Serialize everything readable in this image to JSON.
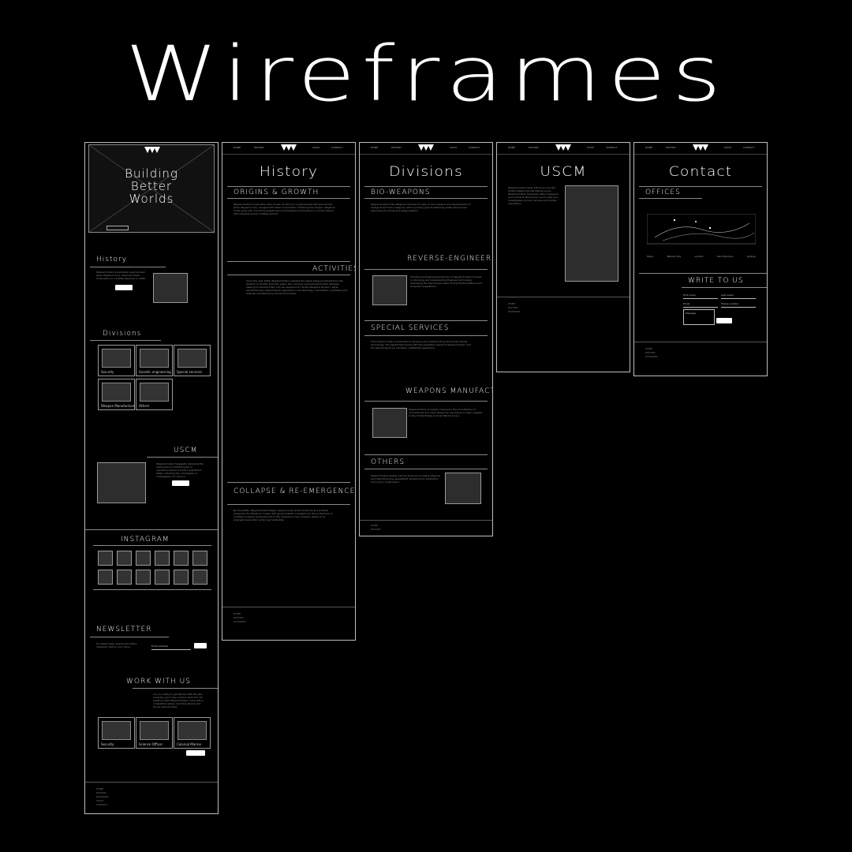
{
  "title": "Wireframes",
  "nav": [
    "HOME",
    "HISTORY",
    "DIVISIONS",
    "USCM",
    "CONTACT"
  ],
  "home": {
    "hero": [
      "Building",
      "Better",
      "Worlds"
    ],
    "history_title": "History",
    "history_text": "Weyland-Yutani Corporation was founded when Weyland Corp. Acquired Yutani Corporation in a hostile takeover in 2099.",
    "divisions_title": "Divisions",
    "divisions": [
      "Security",
      "Genetic engineering",
      "Special services",
      "Weapon Manufacture",
      "Others"
    ],
    "uscm_title": "USCM",
    "uscm_text": "Weyland-Yutani frequently demands the deployment of USCM troops in operations where it holds a significant stake, including the colonization or investigation of colony's.",
    "instagram_title": "Instagram",
    "newsletter_title": "Newsletter",
    "newsletter_text": "For latest news, events and offers, delivered right to your inbox.",
    "email_placeholder": "Email address",
    "work_title": "Work with us",
    "work_text": "Are you ready to get started with the last company you'll ever need to work for? All positions with Weyland-Yutani come with a competitive salary including shares and bonus opportunities.",
    "work_cards": [
      "Security",
      "Science Officer",
      "Colonial Marine"
    ]
  },
  "history": {
    "title": "History",
    "s1": "Origins & Growth",
    "s1_text": "Weyland-Yutani Corporation (also known as WY) is a conglomerate that was formed when Weyland Corp. merged with Yutani Corporation. Following the merger, Weyland-Yutani grew into one of the largest and most powerful corporations in human history, with interests across multiple sectors.",
    "s2": "Activities",
    "s2_text": "Since the year 2099, Weyland-Yutani adopted the signal being broadcast from the derelict on LV-426. Over the years, the company pursued xenomorph samples, seeking to develop them into bio-weapons for its Bio-Weapons Division, while simultaneously expanding its operations in terraforming, colonization, synthetics and defense manufacturing across the frontier.",
    "s3": "Collapse & Re-Emergence",
    "s3_text": "By the 2200s, Weyland-Yutani began experiencing serious financial and political pressures. Its refusal to comply with governmental oversight and its involvement in multiple incidents eventually led to the company's near collapse, before it re-emerged years later under new leadership."
  },
  "divisions": {
    "title": "Divisions",
    "items": [
      "Bio-Weapons",
      "Reverse-Engineering",
      "Special Services",
      "Weapons Manufacture",
      "Others"
    ],
    "bio_text": "Weyland-Yutani's Bio-Weapons Division focuses on the research and development of biological and toxic weapons, with a primary goal of obtaining viable Xenomorph specimens for study and weaponization.",
    "rev_text": "The Reverse-Engineering Division of Weyland-Yutani focuses on studying and implementing Engineer technology, leveraging the discoveries made during the Prometheus and Covenant expeditions.",
    "spec_text": "This division's task is dedicated to studying and implementing xenomorph facility technology. The department works with the expedition teams of Weyland-Yutani and the Special Services, handling confidential operations.",
    "weap_text": "Weyland-Yutani is heavily involved in the manufacture of conventional and other weaponry, serving as a major supplier to the United States Colonial Marine Corps.",
    "other_text": "Weyland-Yutani boasts various divisions including shipping and manufacturing, spaceflight, terraforming, synthetics and colony construction."
  },
  "uscm": {
    "title": "USCM",
    "text": "Weyland-Yutani holds influence over the United States Colonial Marine Corps. Weyland-Yutani frequently sells it weapons and contracts Marines for escort duty and investigation across colonies and frontier operations."
  },
  "contact": {
    "title": "Contact",
    "offices": "Offices",
    "cities": [
      "Tokyo",
      "Mexico City",
      "London",
      "San Francisco",
      "Sydney"
    ],
    "write": "Write to us",
    "first": "First name",
    "last": "Last name",
    "email": "Email",
    "phone": "Phone number",
    "message": "Message"
  }
}
